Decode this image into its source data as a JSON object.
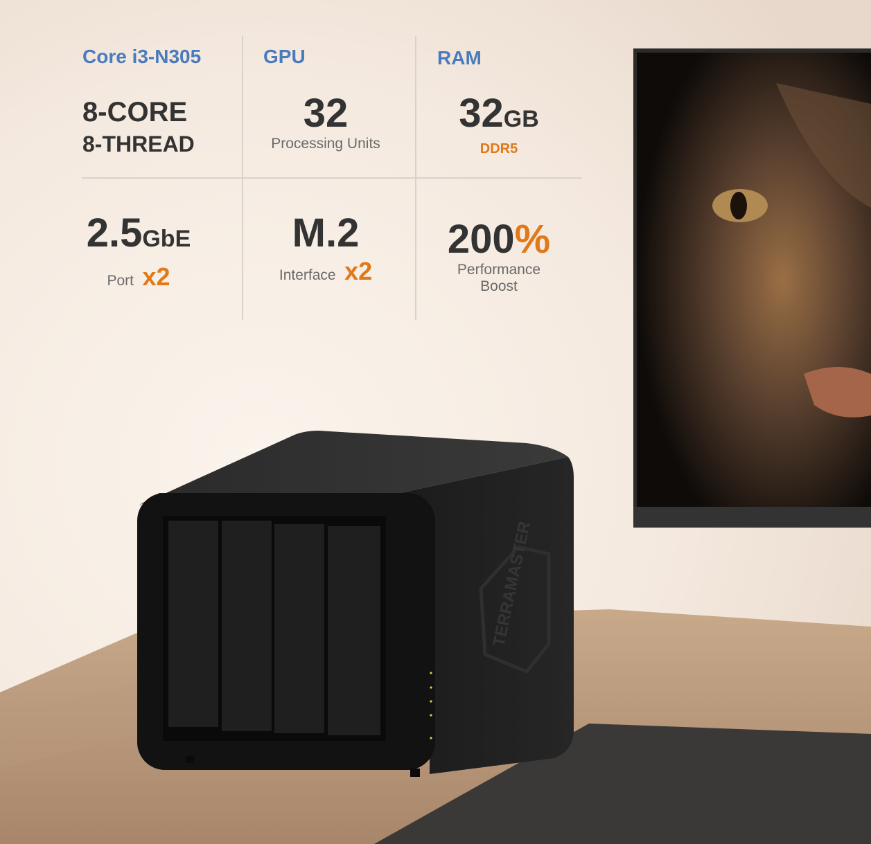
{
  "colors": {
    "accent_blue": "#4a7bbd",
    "accent_orange": "#e0791a",
    "text_dark": "#333333",
    "text_gray": "#6a6a6a",
    "wall": "#f7efe7",
    "desk": "#b59577",
    "device": "#1d1d1d"
  },
  "specs": {
    "cpu": {
      "category": "Core i3-N305",
      "line1": "8-CORE",
      "line2": "8-THREAD"
    },
    "gpu": {
      "category": "GPU",
      "value": "32",
      "caption": "Processing Units"
    },
    "ram": {
      "category": "RAM",
      "value": "32",
      "unit": "GB",
      "caption": "DDR5"
    },
    "network": {
      "value": "2.5",
      "unit": "GbE",
      "caption": "Port",
      "count": "x2"
    },
    "storage": {
      "value": "M.2",
      "caption": "Interface",
      "count": "x2"
    },
    "performance": {
      "value": "200",
      "unit": "%",
      "caption_line1": "Performance",
      "caption_line2": "Boost"
    }
  },
  "device": {
    "brand": "TERRAMASTER",
    "bays": 4
  },
  "monitor": {
    "subject": "lynx-face"
  },
  "icons": [
    "brand-hexagon-logo",
    "led-indicator"
  ]
}
